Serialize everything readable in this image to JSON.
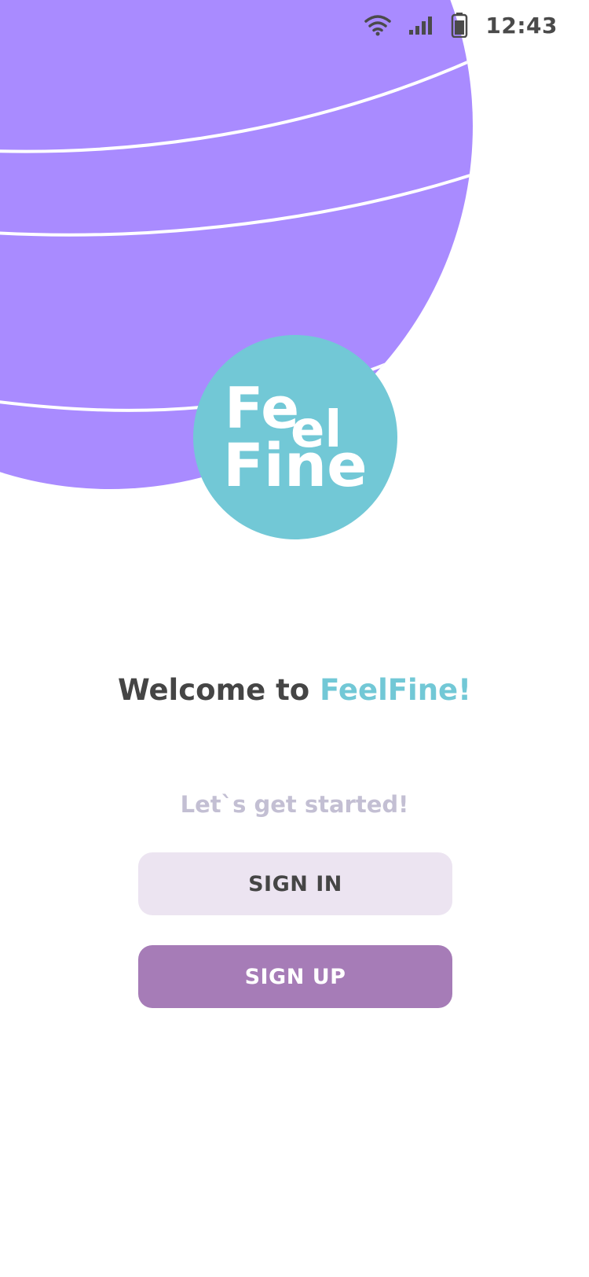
{
  "status_bar": {
    "time": "12:43",
    "icons": [
      "wifi-icon",
      "cellular-signal-icon",
      "battery-icon"
    ]
  },
  "logo": {
    "line1_a": "Fe",
    "line1_b": "el",
    "line2": "Fine",
    "badge_color": "#72c8d6"
  },
  "welcome": {
    "prefix": "Welcome to ",
    "brand": "FeelFine!"
  },
  "subtitle": "Let`s get started!",
  "buttons": {
    "sign_in": "SIGN IN",
    "sign_up": "SIGN UP"
  },
  "colors": {
    "hero_purple": "#a98bff",
    "accent_teal": "#72c8d6",
    "signin_bg": "#ece4f1",
    "signup_bg": "#a67cb7",
    "text_dark": "#454545",
    "text_muted": "#c3bfd3"
  }
}
